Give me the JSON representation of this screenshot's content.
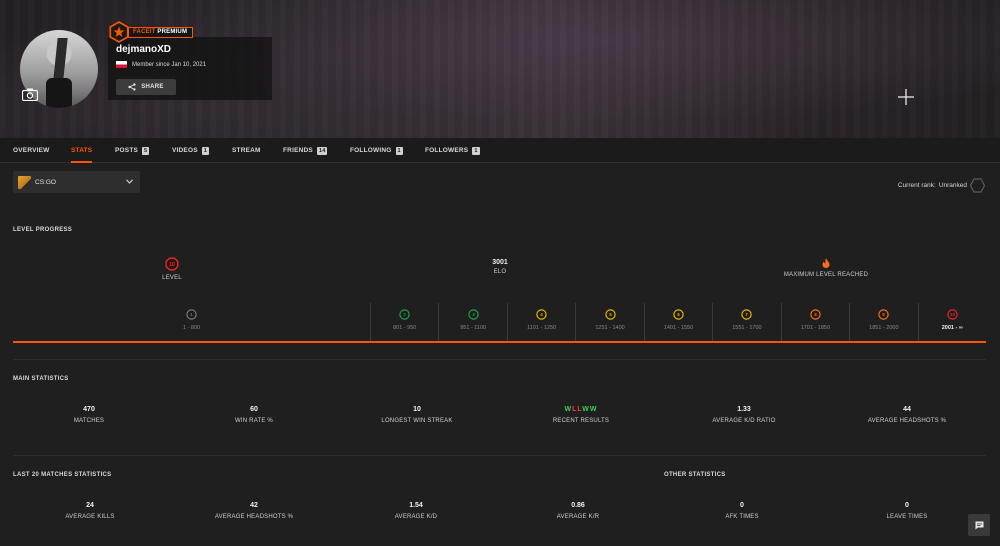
{
  "profile": {
    "premium_brand": "FACEIT",
    "premium_tier": "PREMIUM",
    "username": "dejmanoXD",
    "member_since": "Member since Jan 10, 2021",
    "share_label": "SHARE",
    "flag_country": "Poland"
  },
  "tabs": [
    {
      "label": "OVERVIEW",
      "count": null,
      "active": false
    },
    {
      "label": "STATS",
      "count": null,
      "active": true
    },
    {
      "label": "POSTS",
      "count": "5",
      "active": false
    },
    {
      "label": "VIDEOS",
      "count": "1",
      "active": false
    },
    {
      "label": "STREAM",
      "count": null,
      "active": false
    },
    {
      "label": "FRIENDS",
      "count": "14",
      "active": false
    },
    {
      "label": "FOLLOWING",
      "count": "1",
      "active": false
    },
    {
      "label": "FOLLOWERS",
      "count": "1",
      "active": false
    }
  ],
  "game_select": {
    "value": "CS:GO"
  },
  "rank": {
    "label": "Current rank:",
    "value": "Unranked"
  },
  "level_progress": {
    "title": "LEVEL PROGRESS",
    "level_label": "LEVEL",
    "level_value": "10",
    "elo_value": "3001",
    "elo_label": "ELO",
    "max_label": "MAXIMUM LEVEL REACHED",
    "progress": 1.0,
    "ranges": [
      {
        "range": "1 - 800",
        "level": "1",
        "color": "#7a7a7a"
      },
      {
        "range": "801 - 950",
        "level": "2",
        "color": "#1ca24d"
      },
      {
        "range": "951 - 1100",
        "level": "3",
        "color": "#1ca24d"
      },
      {
        "range": "1101 - 1250",
        "level": "4",
        "color": "#e6b800"
      },
      {
        "range": "1251 - 1400",
        "level": "5",
        "color": "#e6b800"
      },
      {
        "range": "1401 - 1550",
        "level": "6",
        "color": "#e6b800"
      },
      {
        "range": "1551 - 1700",
        "level": "7",
        "color": "#e6b800"
      },
      {
        "range": "1701 - 1850",
        "level": "8",
        "color": "#ff6a1a"
      },
      {
        "range": "1851 - 2000",
        "level": "9",
        "color": "#ff6a1a"
      },
      {
        "range": "2001 - ∞",
        "level": "10",
        "color": "#e22a2a"
      }
    ]
  },
  "main_statistics": {
    "title": "MAIN STATISTICS",
    "items": [
      {
        "value": "470",
        "label": "MATCHES"
      },
      {
        "value": "60",
        "label": "WIN RATE %"
      },
      {
        "value": "10",
        "label": "LONGEST WIN STREAK"
      },
      {
        "value": "W L L W W",
        "label": "RECENT RESULTS",
        "results": [
          "W",
          "L",
          "L",
          "W",
          "W"
        ]
      },
      {
        "value": "1.33",
        "label": "AVERAGE K/D RATIO"
      },
      {
        "value": "44",
        "label": "AVERAGE HEADSHOTS %"
      }
    ]
  },
  "last20": {
    "title": "LAST 20 MATCHES STATISTICS",
    "items": [
      {
        "value": "24",
        "label": "AVERAGE KILLS"
      },
      {
        "value": "42",
        "label": "AVERAGE HEADSHOTS %"
      },
      {
        "value": "1.54",
        "label": "AVERAGE K/D"
      },
      {
        "value": "0.86",
        "label": "AVERAGE K/R"
      }
    ]
  },
  "other": {
    "title": "OTHER STATISTICS",
    "items": [
      {
        "value": "0",
        "label": "AFK TIMES"
      },
      {
        "value": "0",
        "label": "LEAVE TIMES"
      }
    ]
  },
  "colors": {
    "accent": "#ff5500",
    "win": "#32d35a",
    "loss": "#ff3b3b",
    "background": "#1f1f1f"
  }
}
